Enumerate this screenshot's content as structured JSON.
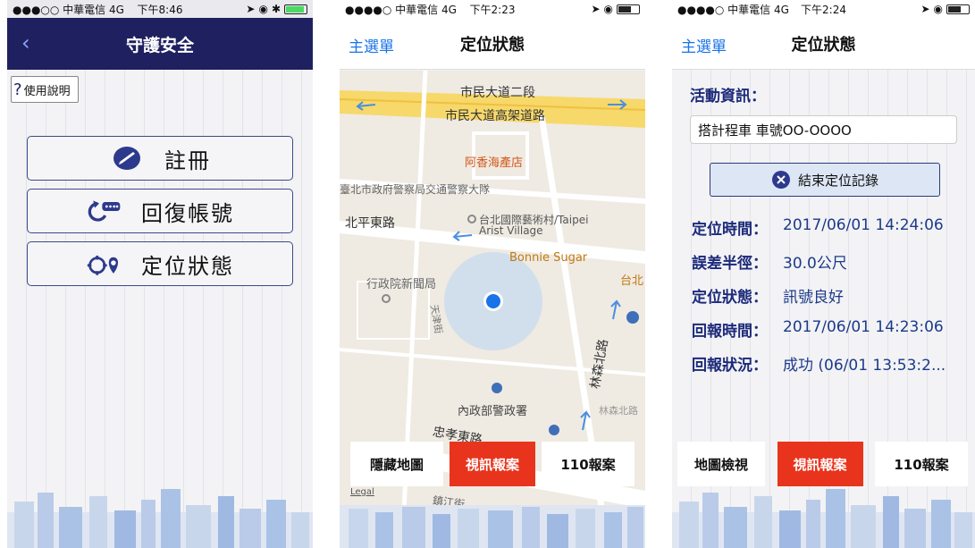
{
  "screen1": {
    "status": {
      "left": "●●●○○ 中華電信 4G",
      "time": "下午8:46"
    },
    "nav_title": "守護安全",
    "back_icon": "chevron-left-icon",
    "help_label": "使用說明",
    "menu": [
      {
        "label": "註冊",
        "icon": "register-icon"
      },
      {
        "label": "回復帳號",
        "icon": "restore-account-icon"
      },
      {
        "label": "定位狀態",
        "icon": "location-status-icon"
      }
    ]
  },
  "screen2": {
    "status": {
      "left": "●●●●○ 中華電信 4G",
      "time": "下午2:23"
    },
    "nav_left": "主選單",
    "nav_title": "定位狀態",
    "map_labels": {
      "road1": "市民大道二段",
      "road2": "市民大道高架道路",
      "poi1": "阿香海產店",
      "poi2": "臺北市政府警察局交通警察大隊",
      "road3": "北平東路",
      "poi3": "台北國際藝術村/Taipei",
      "poi3b": "Arist Village",
      "poi4": "Bonnie Sugar",
      "poi5": "台北",
      "poi6": "行政院新聞局",
      "road4": "天津街",
      "road5": "林森北路",
      "poi7": "內政部警政署",
      "road6": "林森北路",
      "road7": "忠孝東路",
      "road8": "鎮江街",
      "legal": "Legal"
    },
    "buttons": {
      "hide_map": "隱藏地圖",
      "video_report": "視訊報案",
      "report_110": "110報案"
    }
  },
  "screen3": {
    "status": {
      "left": "●●●●○ 中華電信 4G",
      "time": "下午2:24"
    },
    "nav_left": "主選單",
    "nav_title": "定位狀態",
    "activity_label": "活動資訊：",
    "activity_value": "搭計程車 車號OO-OOOO",
    "end_button": "結束定位記錄",
    "rows": [
      {
        "key": "定位時間：",
        "value": "2017/06/01 14:24:06"
      },
      {
        "key": "誤差半徑：",
        "value": "30.0公尺"
      },
      {
        "key": "定位狀態：",
        "value": "訊號良好"
      },
      {
        "key": "回報時間：",
        "value": "2017/06/01 14:23:06"
      },
      {
        "key": "回報狀況：",
        "value": "成功 (06/01 13:53:2..."
      }
    ],
    "buttons": {
      "map_view": "地圖檢視",
      "video_report": "視訊報案",
      "report_110": "110報案"
    }
  },
  "colors": {
    "navy": "#1f2060",
    "accent_red": "#e8341c",
    "link_blue": "#1a73e8",
    "location_dot": "#1a73e8"
  }
}
